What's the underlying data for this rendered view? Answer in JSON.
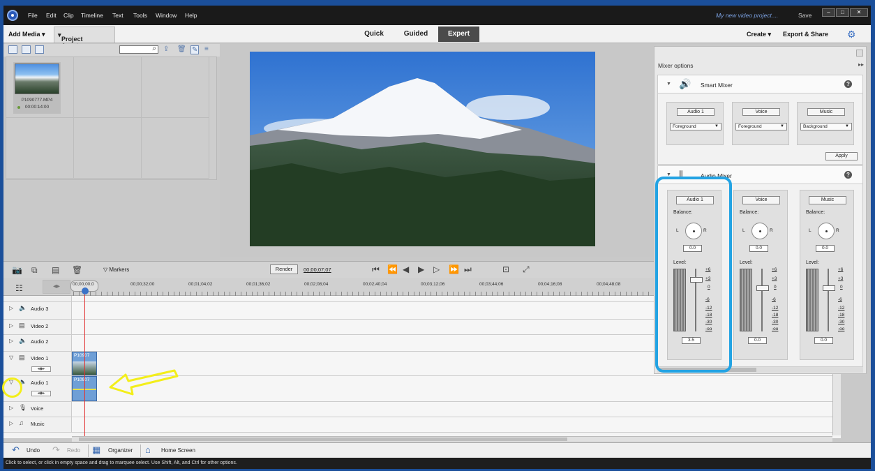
{
  "menubar": {
    "items": [
      "File",
      "Edit",
      "Clip",
      "Timeline",
      "Text",
      "Tools",
      "Window",
      "Help"
    ],
    "project_name": "My new video project....",
    "save": "Save"
  },
  "modebar": {
    "add_media": "Add Media",
    "project_assets": "Project Assets",
    "tabs": [
      "Quick",
      "Guided",
      "Expert"
    ],
    "active_tab": "Expert",
    "create": "Create",
    "export_share": "Export & Share"
  },
  "assets": {
    "file_name": "P1090777.MP4",
    "duration": "00:00:14:00"
  },
  "transport": {
    "markers": "Markers",
    "render": "Render",
    "timecode": "00;00;07;07"
  },
  "timeline": {
    "ruler_ticks": [
      "00;00;00;0",
      "00;00;32;00",
      "00;01;04;02",
      "00;01;36;02",
      "00;02;08;04",
      "00;02;40;04",
      "00;03;12;06",
      "00;03;44;06",
      "00;04;16;08",
      "00;04;48;08"
    ],
    "tracks": {
      "audio3": "Audio 3",
      "video2": "Video 2",
      "audio2": "Audio 2",
      "video1": "Video 1",
      "audio1": "Audio 1",
      "voice": "Voice",
      "music": "Music"
    },
    "clip_label": "P10907"
  },
  "bottom": {
    "undo": "Undo",
    "redo": "Redo",
    "organizer": "Organizer",
    "home_screen": "Home Screen"
  },
  "status": "Click to select, or click in empty space and drag to marquee select. Use Shift, Alt, and Ctrl for other options.",
  "mixer": {
    "title": "Mixer options",
    "smart_mixer": "Smart Mixer",
    "audio_mixer": "Audio Mixer",
    "apply": "Apply",
    "smart": {
      "audio1": {
        "name": "Audio 1",
        "value": "Foreground"
      },
      "voice": {
        "name": "Voice",
        "value": "Foreground"
      },
      "music": {
        "name": "Music",
        "value": "Background"
      }
    },
    "balance_label": "Balance:",
    "level_label": "Level:",
    "l": "L",
    "r": "R",
    "scale": [
      "+6",
      "+3",
      "0",
      "-6",
      "-12",
      "-18",
      "-30",
      "-oo"
    ],
    "channels": {
      "audio1": {
        "name": "Audio 1",
        "balance": "0.0",
        "level": "3.5"
      },
      "voice": {
        "name": "Voice",
        "balance": "0.0",
        "level": "0.0"
      },
      "music": {
        "name": "Music",
        "balance": "0.0",
        "level": "0.0"
      }
    }
  },
  "colors": {
    "highlight_blue": "#23a3e3",
    "annotation_yellow": "#f3ee1a",
    "playhead_red": "#e23030"
  }
}
